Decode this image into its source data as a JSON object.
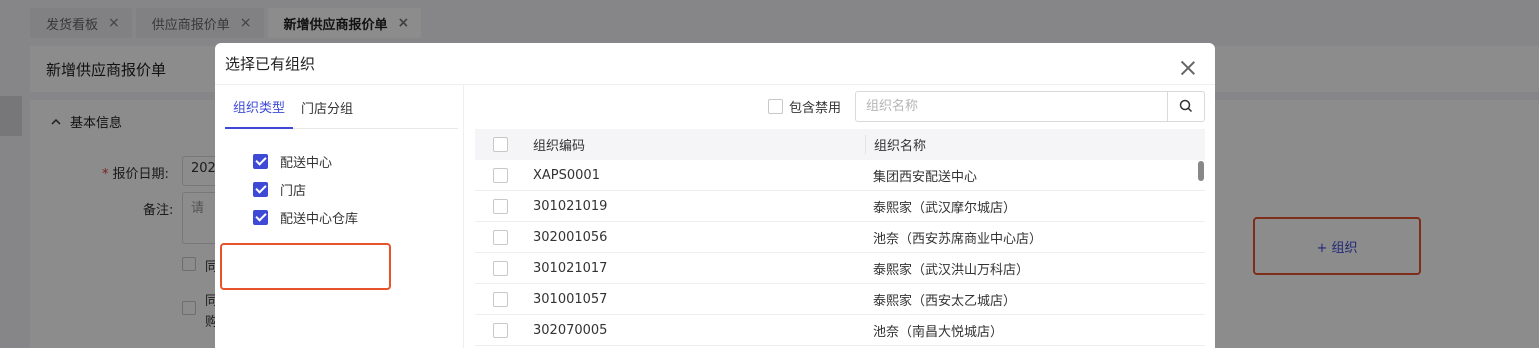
{
  "tabs": [
    {
      "label": "发货看板"
    },
    {
      "label": "供应商报价单"
    },
    {
      "label": "新增供应商报价单"
    }
  ],
  "page": {
    "title": "新增供应商报价单",
    "section_title": "基本信息",
    "quote_date_label": "报价日期:",
    "quote_date_value": "202",
    "remark_label": "备注:",
    "remark_placeholder": "请",
    "check1_label": "同",
    "check2_label_line1": "同",
    "check2_label_line2": "购",
    "add_org_label": "+ 组织"
  },
  "modal": {
    "title": "选择已有组织",
    "left_tabs": [
      {
        "label": "组织类型",
        "active": true
      },
      {
        "label": "门店分组",
        "active": false
      }
    ],
    "types": [
      {
        "label": "配送中心",
        "checked": true
      },
      {
        "label": "门店",
        "checked": true
      },
      {
        "label": "配送中心仓库",
        "checked": true
      }
    ],
    "include_disabled_label": "包含禁用",
    "search_placeholder": "组织名称",
    "columns": {
      "code": "组织编码",
      "name": "组织名称"
    },
    "rows": [
      {
        "code": "XAPS0001",
        "name": "集团西安配送中心"
      },
      {
        "code": "301021019",
        "name": "泰熙家（武汉摩尔城店）"
      },
      {
        "code": "302001056",
        "name": "池奈（西安苏席商业中心店）"
      },
      {
        "code": "301021017",
        "name": "泰熙家（武汉洪山万科店）"
      },
      {
        "code": "301001057",
        "name": "泰熙家（西安太乙城店）"
      },
      {
        "code": "302070005",
        "name": "池奈（南昌大悦城店）"
      }
    ]
  },
  "colors": {
    "accent": "#3e4ad6",
    "highlight": "#e8532c",
    "required": "#e23b3b"
  }
}
